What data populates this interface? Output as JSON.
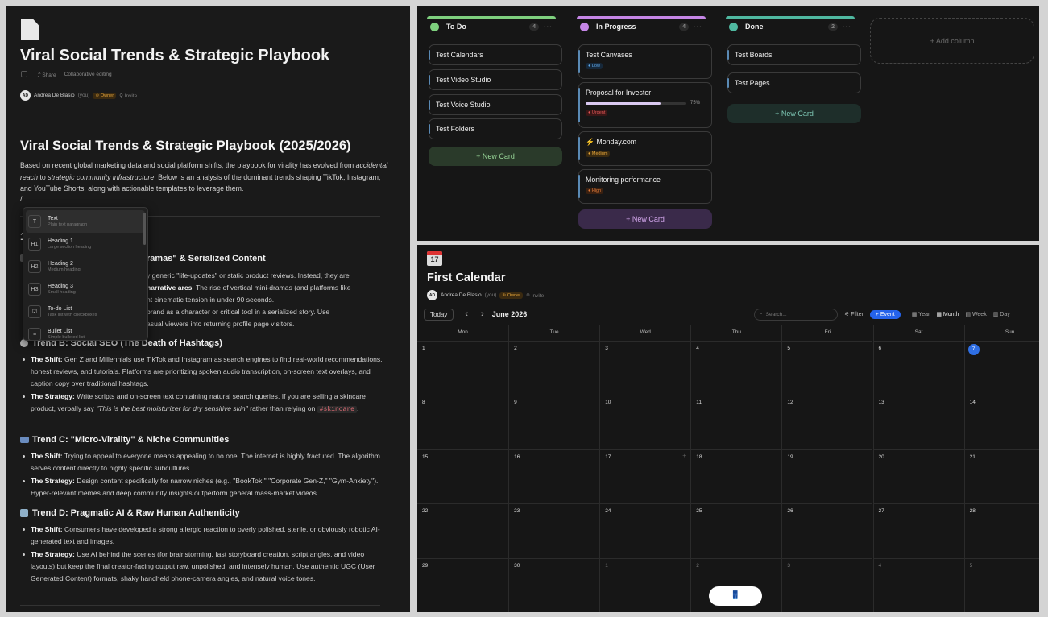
{
  "doc": {
    "title": "Viral Social Trends & Strategic Playbook",
    "share": "Share",
    "collab": "Collaborative editing",
    "user_initials": "AD",
    "user_name": "Andrea De Blasio",
    "user_you": "(you)",
    "owner": "Owner",
    "invite": "Invite",
    "h1": "Viral Social Trends & Strategic Playbook (2025/2026)",
    "intro_1": "Based on recent global marketing data and social platform shifts, the playbook for virality has evolved from ",
    "intro_i1": "accidental reach",
    "intro_2": " to ",
    "intro_i2": "strategic community infrastructure",
    "intro_3": ". Below is an analysis of the dominant trends shaping TikTok, Instagram, and YouTube Shorts, along with actionable templates to leverage them.",
    "slash": "/",
    "trend_a_title": "ramas\" & Serialized Content",
    "trend_a_1a": "y generic \"life-updates\" or static product reviews. Instead, they are",
    "trend_a_1b": "narrative arcs",
    "trend_a_1c": ". The rise of vertical mini-dramas (and platforms like",
    "trend_a_1d": "nt cinematic tension in under 90 seconds.",
    "trend_a_2a": " brand as a character or critical tool in a serialized story. Use",
    "trend_a_2b": "asual viewers into returning profile page visitors.",
    "trend_b_title": "Trend B: Social SEO (The Death of Hashtags)",
    "shift_label": "The Shift:",
    "strategy_label": "The Strategy:",
    "trend_b_shift": " Gen Z and Millennials use TikTok and Instagram as search engines to find real-world recommendations, honest reviews, and tutorials. Platforms are prioritizing spoken audio transcription, on-screen text overlays, and caption copy over traditional hashtags.",
    "trend_b_strategy": " Write scripts and on-screen text containing natural search queries. If you are selling a skincare product, verbally say ",
    "trend_b_quote": "\"This is the best moisturizer for dry sensitive skin\"",
    "trend_b_strategy2": " rather than relying on ",
    "trend_b_code": "#skincare",
    "trend_b_end": ".",
    "trend_c_title": "Trend C: \"Micro-Virality\" & Niche Communities",
    "trend_c_shift": " Trying to appeal to everyone means appealing to no one. The internet is highly fractured. The algorithm serves content directly to highly specific subcultures.",
    "trend_c_strategy": " Design content specifically for narrow niches (e.g., \"BookTok,\" \"Corporate Gen-Z,\" \"Gym-Anxiety\"). Hyper-relevant memes and deep community insights outperform general mass-market videos.",
    "trend_d_title": "Trend D: Pragmatic AI & Raw Human Authenticity",
    "trend_d_shift": " Consumers have developed a strong allergic reaction to overly polished, sterile, or obviously robotic AI-generated text and images.",
    "trend_d_strategy": " Use AI behind the scenes (for brainstorming, fast storyboard creation, script angles, and video layouts) but keep the final creator-facing output raw, unpolished, and intensely human. Use authentic UGC (User Generated Content) formats, shaky handheld phone-camera angles, and natural voice tones.",
    "menu": [
      {
        "icon": "T",
        "title": "Text",
        "desc": "Plain text paragraph",
        "icon_name": "text-icon"
      },
      {
        "icon": "H1",
        "title": "Heading 1",
        "desc": "Large section heading",
        "icon_name": "heading-1-icon"
      },
      {
        "icon": "H2",
        "title": "Heading 2",
        "desc": "Medium heading",
        "icon_name": "heading-2-icon"
      },
      {
        "icon": "H3",
        "title": "Heading 3",
        "desc": "Small heading",
        "icon_name": "heading-3-icon"
      },
      {
        "icon": "☑",
        "title": "To-do List",
        "desc": "Task list with checkboxes",
        "icon_name": "checkbox-icon"
      },
      {
        "icon": "≡",
        "title": "Bullet List",
        "desc": "Simple bulleted list",
        "icon_name": "bullet-list-icon"
      }
    ]
  },
  "kanban": {
    "columns": [
      {
        "name": "To Do",
        "count": "4",
        "color": "#7ed07e",
        "cards": [
          "Test Calendars",
          "Test Video Studio",
          "Test Voice Studio",
          "Test Folders"
        ],
        "new": "+ New Card"
      },
      {
        "name": "In Progress",
        "count": "4",
        "color": "#c586e6",
        "new": "+ New Card"
      },
      {
        "name": "Done",
        "count": "2",
        "color": "#4fb8a0",
        "cards": [
          "Test Boards",
          "Test Pages"
        ],
        "new": "+ New Card"
      }
    ],
    "progress_cards": [
      {
        "title": "Test Canvases",
        "badge": "Low",
        "badge_color": "#5ea7e8"
      },
      {
        "title": "Proposal for Investor",
        "progress": "75%",
        "progress_value": 0.75,
        "badge": "Urgent",
        "badge_color": "#e05555"
      },
      {
        "title": "Monday.com",
        "icon": "⚡",
        "badge": "Medium",
        "badge_color": "#e5a53a"
      },
      {
        "title": "Monitoring performance",
        "badge": "High",
        "badge_color": "#e07a3a"
      }
    ],
    "add_column": "+ Add column"
  },
  "calendar": {
    "icon_day": "17",
    "title": "First Calendar",
    "user_initials": "AD",
    "user_name": "Andrea De Blasio",
    "user_you": "(you)",
    "owner": "Owner",
    "invite": "Invite",
    "today": "Today",
    "prev": "‹",
    "next": "›",
    "month": "June 2026",
    "search_placeholder": "Search...",
    "filter": "Filter",
    "event": "+ Event",
    "views": [
      "Year",
      "Month",
      "Week",
      "Day"
    ],
    "weekdays": [
      "Mon",
      "Tue",
      "Wed",
      "Thu",
      "Fri",
      "Sat",
      "Sun"
    ],
    "weeks": [
      [
        "1",
        "2",
        "3",
        "4",
        "5",
        "6",
        "7"
      ],
      [
        "8",
        "9",
        "10",
        "11",
        "12",
        "13",
        "14"
      ],
      [
        "15",
        "16",
        "17",
        "18",
        "19",
        "20",
        "21"
      ],
      [
        "22",
        "23",
        "24",
        "25",
        "26",
        "27",
        "28"
      ],
      [
        "29",
        "30",
        "1",
        "2",
        "3",
        "4",
        "5"
      ]
    ],
    "today_date": "7",
    "fab": "👖"
  }
}
